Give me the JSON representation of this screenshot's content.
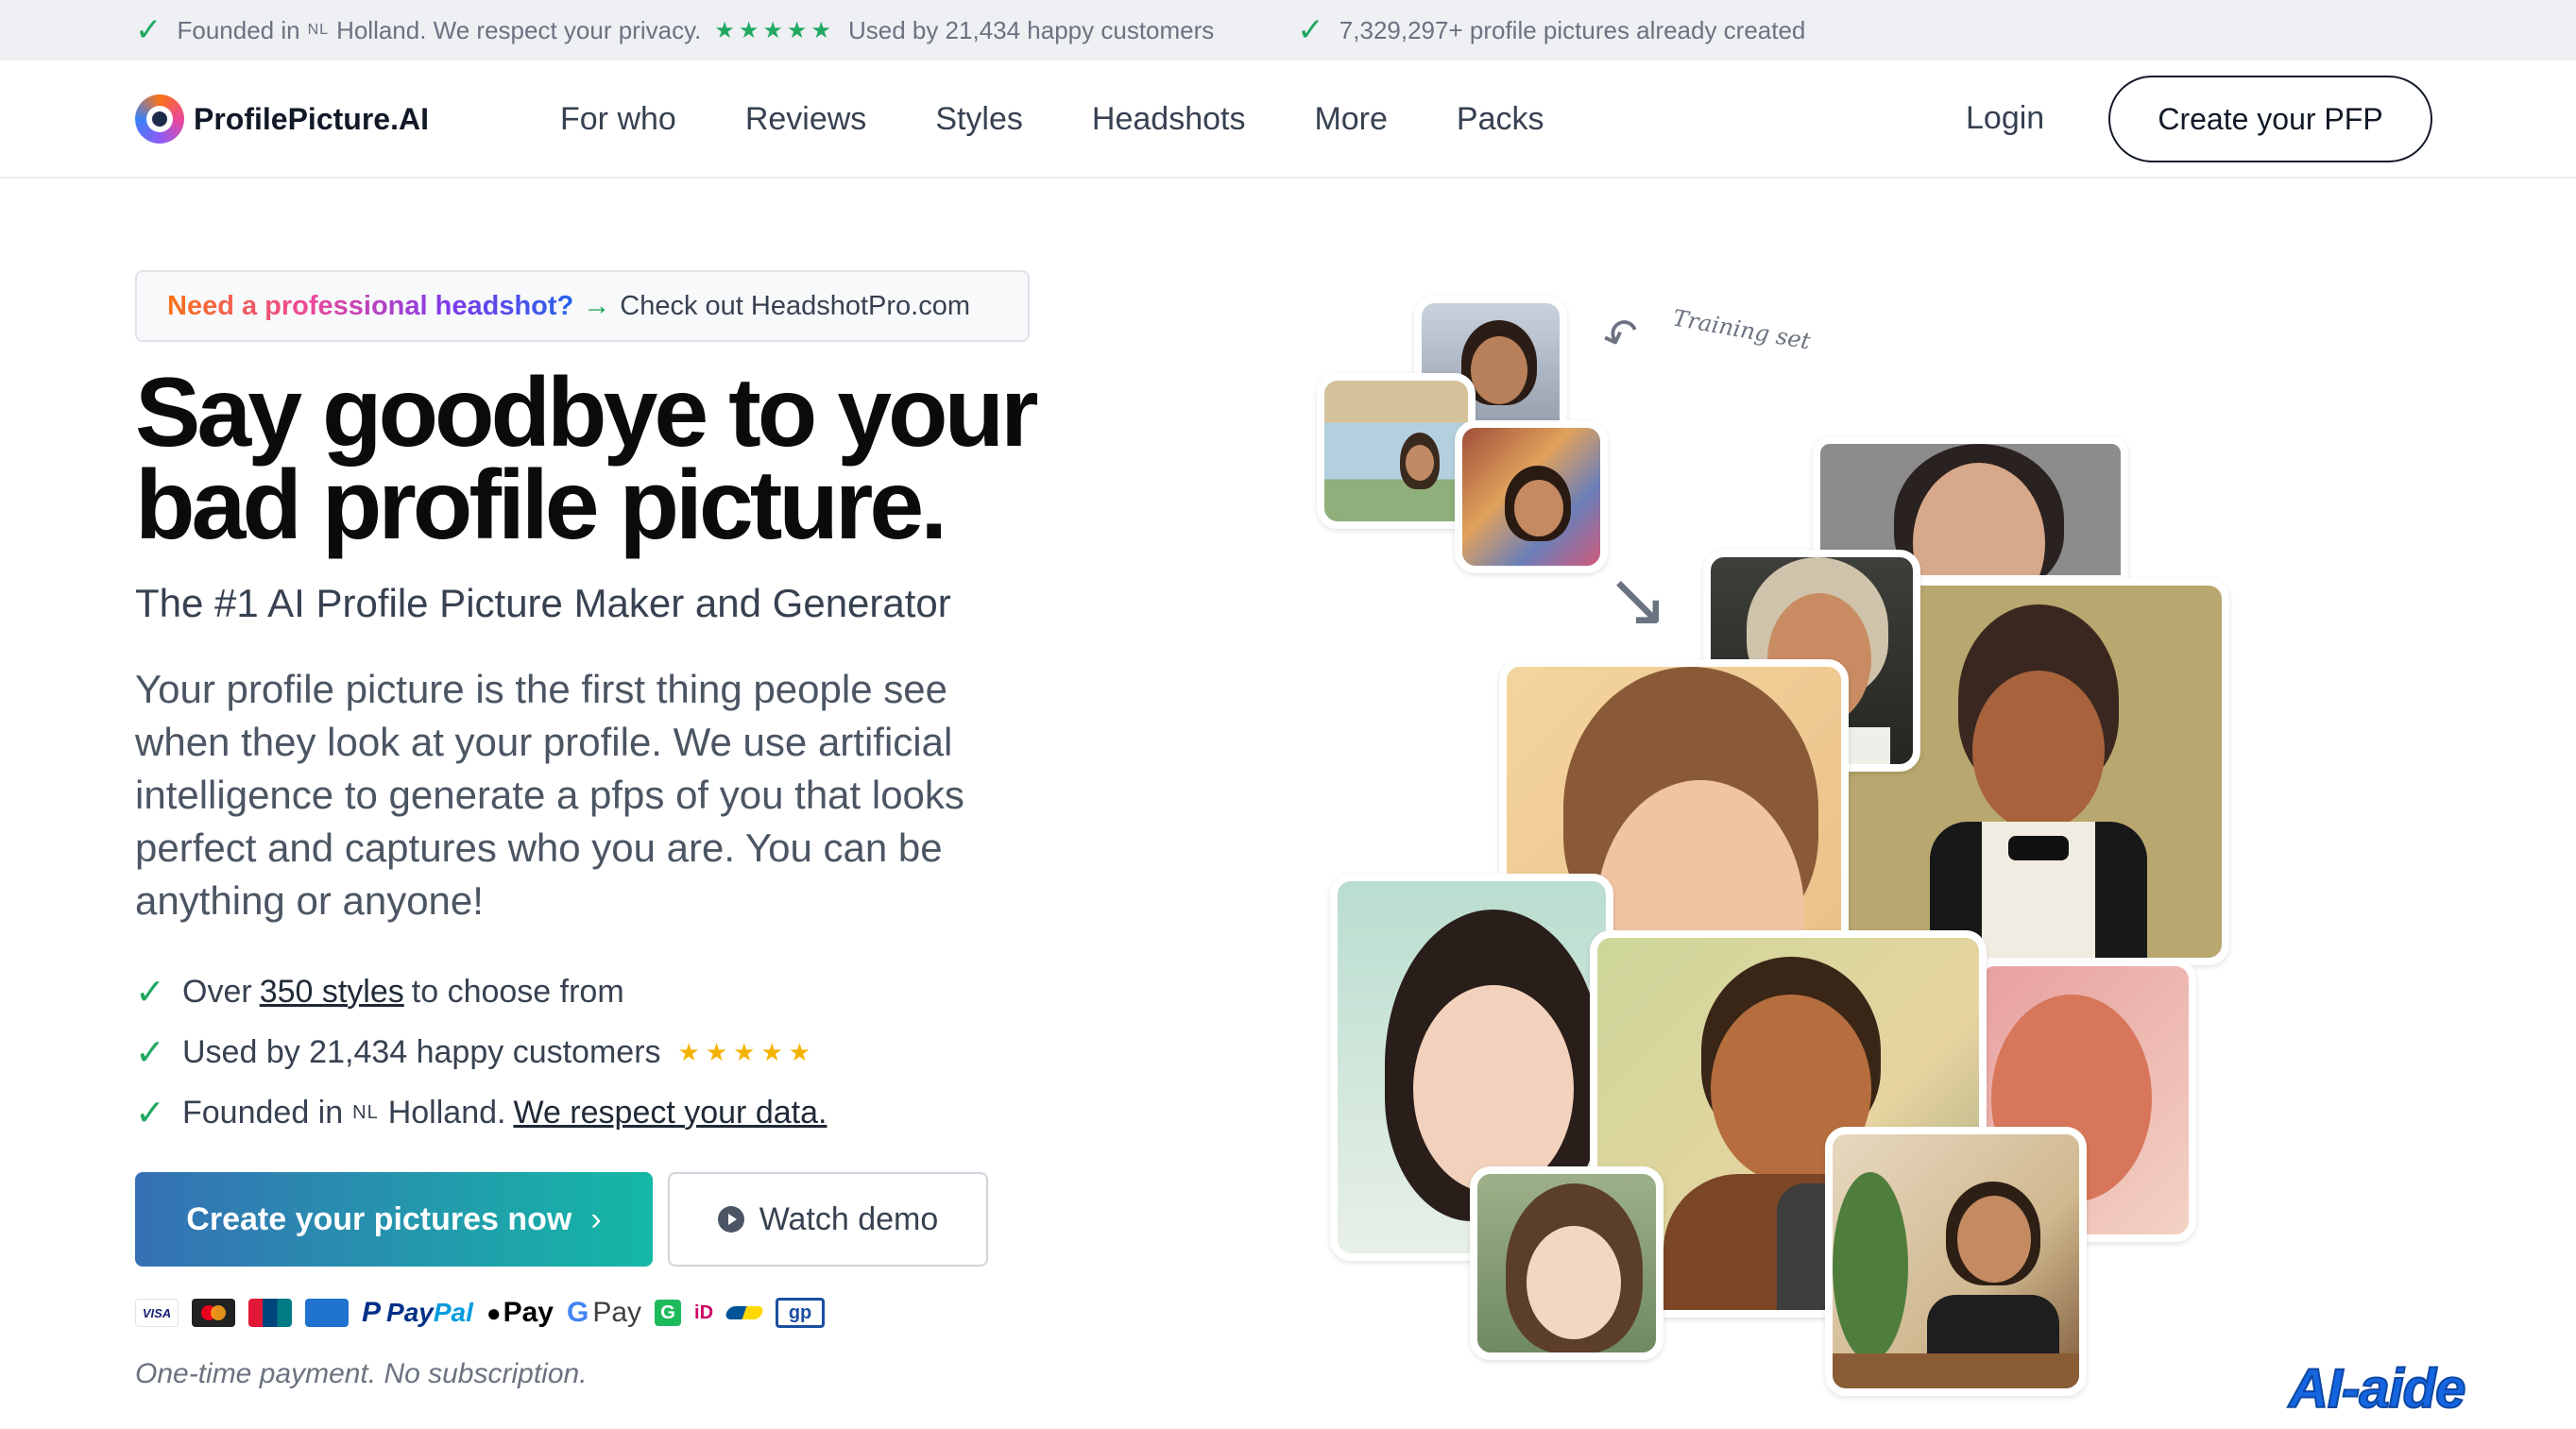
{
  "topbar": {
    "founded_prefix": "Founded in",
    "nl": "NL",
    "founded_suffix": "Holland. We respect your privacy.",
    "stars": "★★★★★",
    "used_by": "Used by 21,434 happy customers",
    "created": "7,329,297+ profile pictures already created"
  },
  "nav": {
    "logo": "ProfilePicture.AI",
    "links": [
      "For who",
      "Reviews",
      "Styles",
      "Headshots",
      "More",
      "Packs"
    ],
    "login": "Login",
    "cta": "Create your PFP"
  },
  "promo": {
    "highlight": "Need a professional headshot?",
    "arrow": "→",
    "text": "Check out HeadshotPro.com"
  },
  "hero": {
    "title_line1": "Say goodbye to your",
    "title_line2": "bad profile picture.",
    "subtitle": "The #1 AI Profile Picture Maker and Generator",
    "paragraph": "Your profile picture is the first thing people see when they look at your profile. We use artificial intelligence to generate a pfps of you that looks perfect and captures who you are. You can be anything or anyone!"
  },
  "bullets": {
    "b1_pre": "Over",
    "b1_link": "350 styles",
    "b1_post": "to choose from",
    "b2": "Used by 21,434 happy customers",
    "b2_stars": "★★★★★",
    "b3_pre": "Founded in",
    "b3_nl": "NL",
    "b3_mid": "Holland.",
    "b3_link": "We respect your data."
  },
  "buttons": {
    "primary": "Create your pictures now",
    "primary_chevron": "›",
    "demo": "Watch demo"
  },
  "payments": {
    "visa": "VISA",
    "paypal_a": "Pay",
    "paypal_b": "Pal",
    "apple_pay": "Pay",
    "google_pay": "Pay",
    "g": "G",
    "ideal": "iD",
    "gp": "gp"
  },
  "onetime": "One-time payment. No subscription.",
  "collage": {
    "training_label": "Training set"
  },
  "watermark": "AI-aide",
  "colors": {
    "accent_green": "#22a861",
    "star_gold": "#f5b301",
    "primary_gradient_start": "#3670b5",
    "primary_gradient_end": "#14b8a6"
  }
}
